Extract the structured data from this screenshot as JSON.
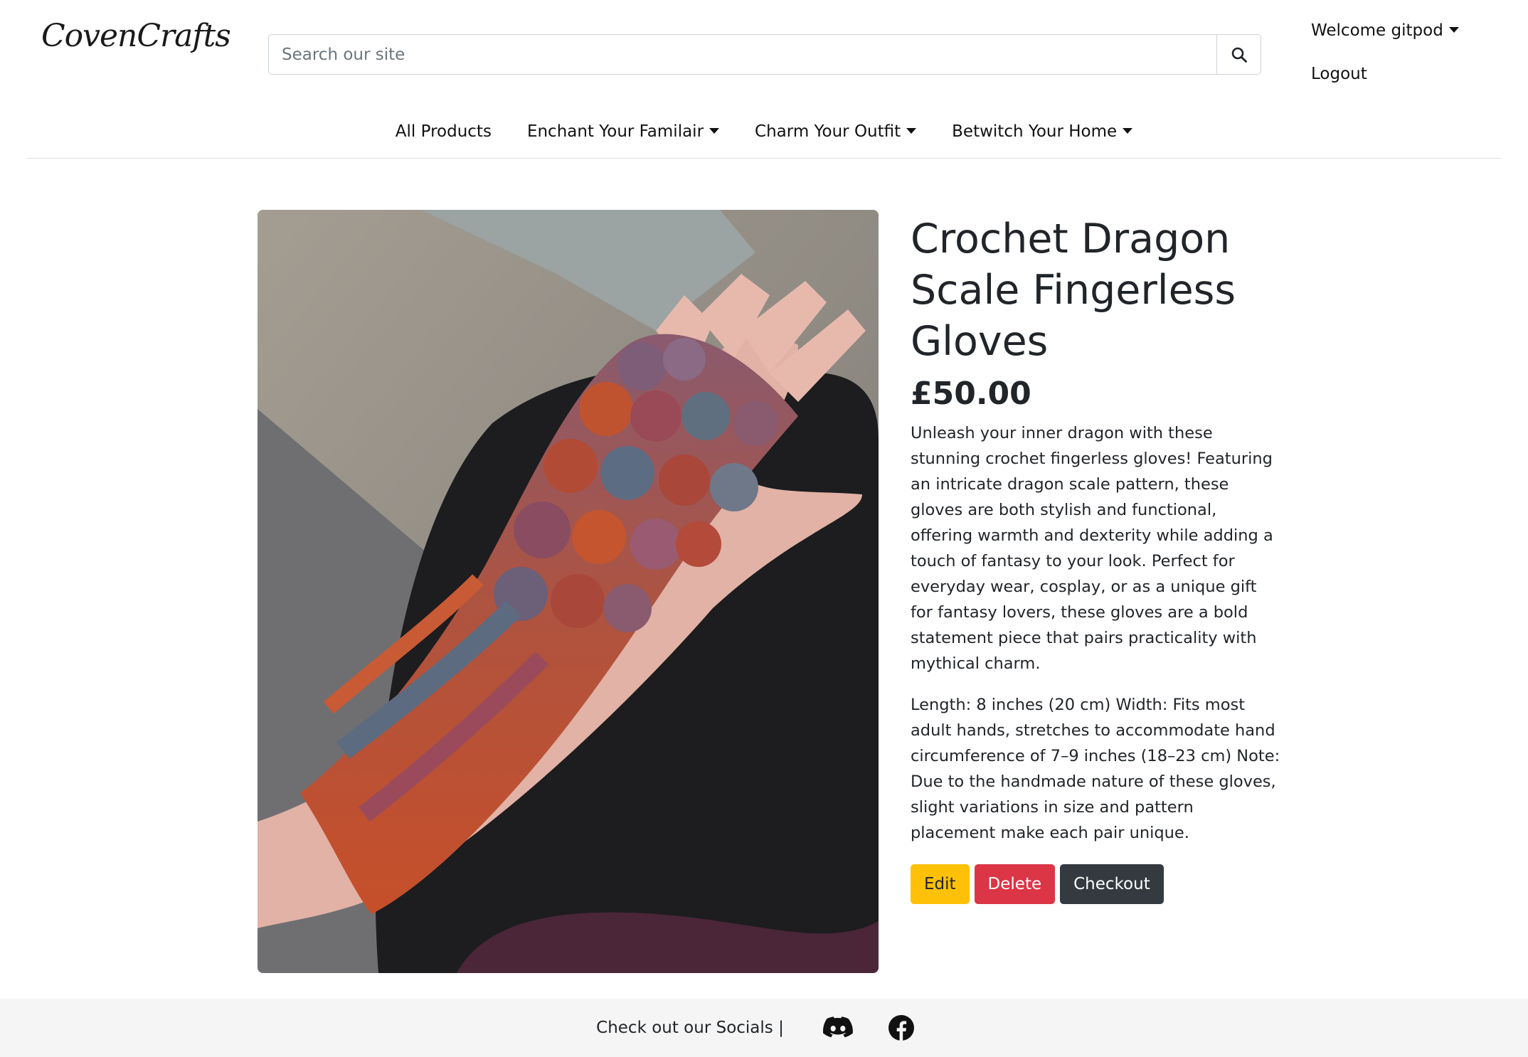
{
  "header": {
    "logo_text": "CovenCrafts",
    "search_placeholder": "Search our site",
    "user_menu_label": "Welcome gitpod",
    "logout_label": "Logout"
  },
  "nav": {
    "items": [
      {
        "label": "All Products",
        "dropdown": false
      },
      {
        "label": "Enchant Your Familair",
        "dropdown": true
      },
      {
        "label": "Charm Your Outfit",
        "dropdown": true
      },
      {
        "label": "Betwitch Your Home",
        "dropdown": true
      }
    ]
  },
  "product": {
    "title": "Crochet Dragon Scale Fingerless Gloves",
    "price": "£50.00",
    "description": "Unleash your inner dragon with these stunning crochet fingerless gloves! Featuring an intricate dragon scale pattern, these gloves are both stylish and functional, offering warmth and dexterity while adding a touch of fantasy to your look. Perfect for everyday wear, cosplay, or as a unique gift for fantasy lovers, these gloves are a bold statement piece that pairs practicality with mythical charm.",
    "dimensions": "Length: 8 inches (20 cm) Width: Fits most adult hands, stretches to accommodate hand circumference of 7–9 inches (18–23 cm) Note: Due to the handmade nature of these gloves, slight variations in size and pattern placement make each pair unique."
  },
  "actions": {
    "edit_label": "Edit",
    "delete_label": "Delete",
    "checkout_label": "Checkout"
  },
  "footer": {
    "socials_text": "Check out our Socials |",
    "icons": [
      "discord-icon",
      "facebook-icon"
    ]
  },
  "colors": {
    "edit": "#ffc107",
    "delete": "#dc3545",
    "checkout": "#343a40",
    "footer_bg": "#f5f5f5"
  }
}
